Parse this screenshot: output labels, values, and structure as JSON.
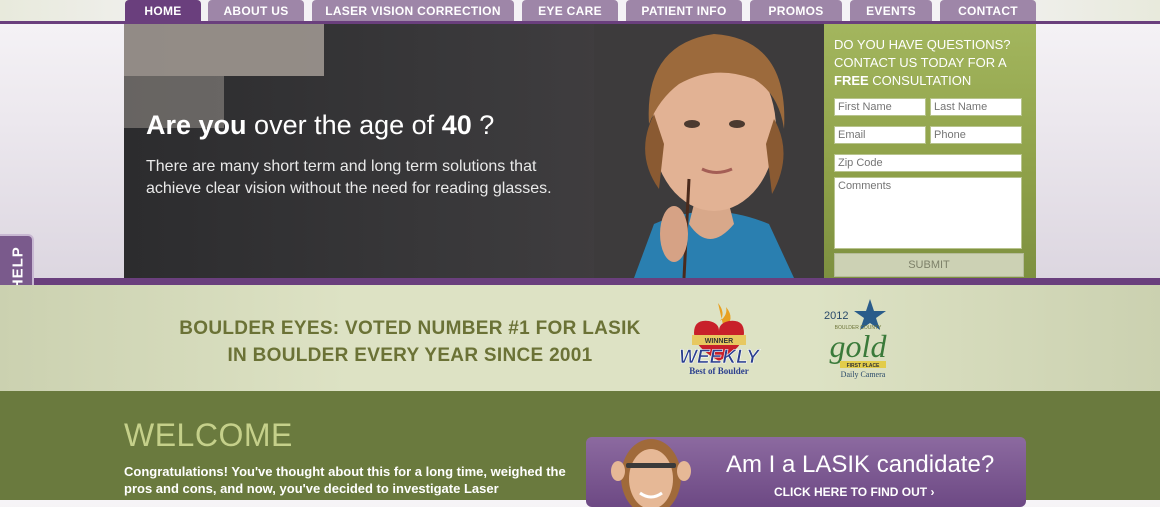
{
  "nav": {
    "items": [
      {
        "label": "HOME",
        "active": true
      },
      {
        "label": "ABOUT US"
      },
      {
        "label": "LASER VISION CORRECTION"
      },
      {
        "label": "EYE CARE"
      },
      {
        "label": "PATIENT INFO"
      },
      {
        "label": "PROMOS"
      },
      {
        "label": "EVENTS"
      },
      {
        "label": "CONTACT"
      }
    ]
  },
  "hero": {
    "headline_bold": "Are you",
    "headline_mid": "over the age of",
    "headline_num": "40",
    "headline_end": "?",
    "subtext": "There are many short term and long term solutions that achieve clear vision without the need for reading glasses."
  },
  "form": {
    "title_line1": "DO YOU HAVE QUESTIONS?",
    "title_line2": "CONTACT US TODAY FOR A",
    "title_free": "FREE",
    "title_end": "CONSULTATION",
    "first_name_placeholder": "First Name",
    "last_name_placeholder": "Last Name",
    "email_placeholder": "Email",
    "phone_placeholder": "Phone",
    "zip_placeholder": "Zip Code",
    "comments_placeholder": "Comments",
    "submit_label": "SUBMIT"
  },
  "awards": {
    "line1": "BOULDER EYES: VOTED NUMBER #1 FOR LASIK",
    "line2": "IN BOULDER EVERY YEAR SINCE 2001",
    "weekly_winner": "WINNER",
    "weekly_name": "WEEKLY",
    "weekly_sub": "Best of Boulder",
    "gold_year": "2012",
    "gold_county": "BOULDER COUNTY",
    "gold_word": "gold",
    "gold_place": "FIRST PLACE",
    "gold_paper": "Daily Camera"
  },
  "welcome": {
    "title": "WELCOME",
    "text": "Congratulations! You've thought about this for a long time, weighed the pros and cons, and now, you've decided to investigate Laser"
  },
  "cta": {
    "title": "Am I a LASIK candidate?",
    "link": "CLICK HERE TO FIND OUT ›"
  },
  "livehelp": {
    "label": "LIVE HELP"
  },
  "colors": {
    "purple": "#6a3f7d",
    "nav_inactive": "#9e86a8",
    "green": "#6a7a3e",
    "form_green": "#8ea048"
  }
}
